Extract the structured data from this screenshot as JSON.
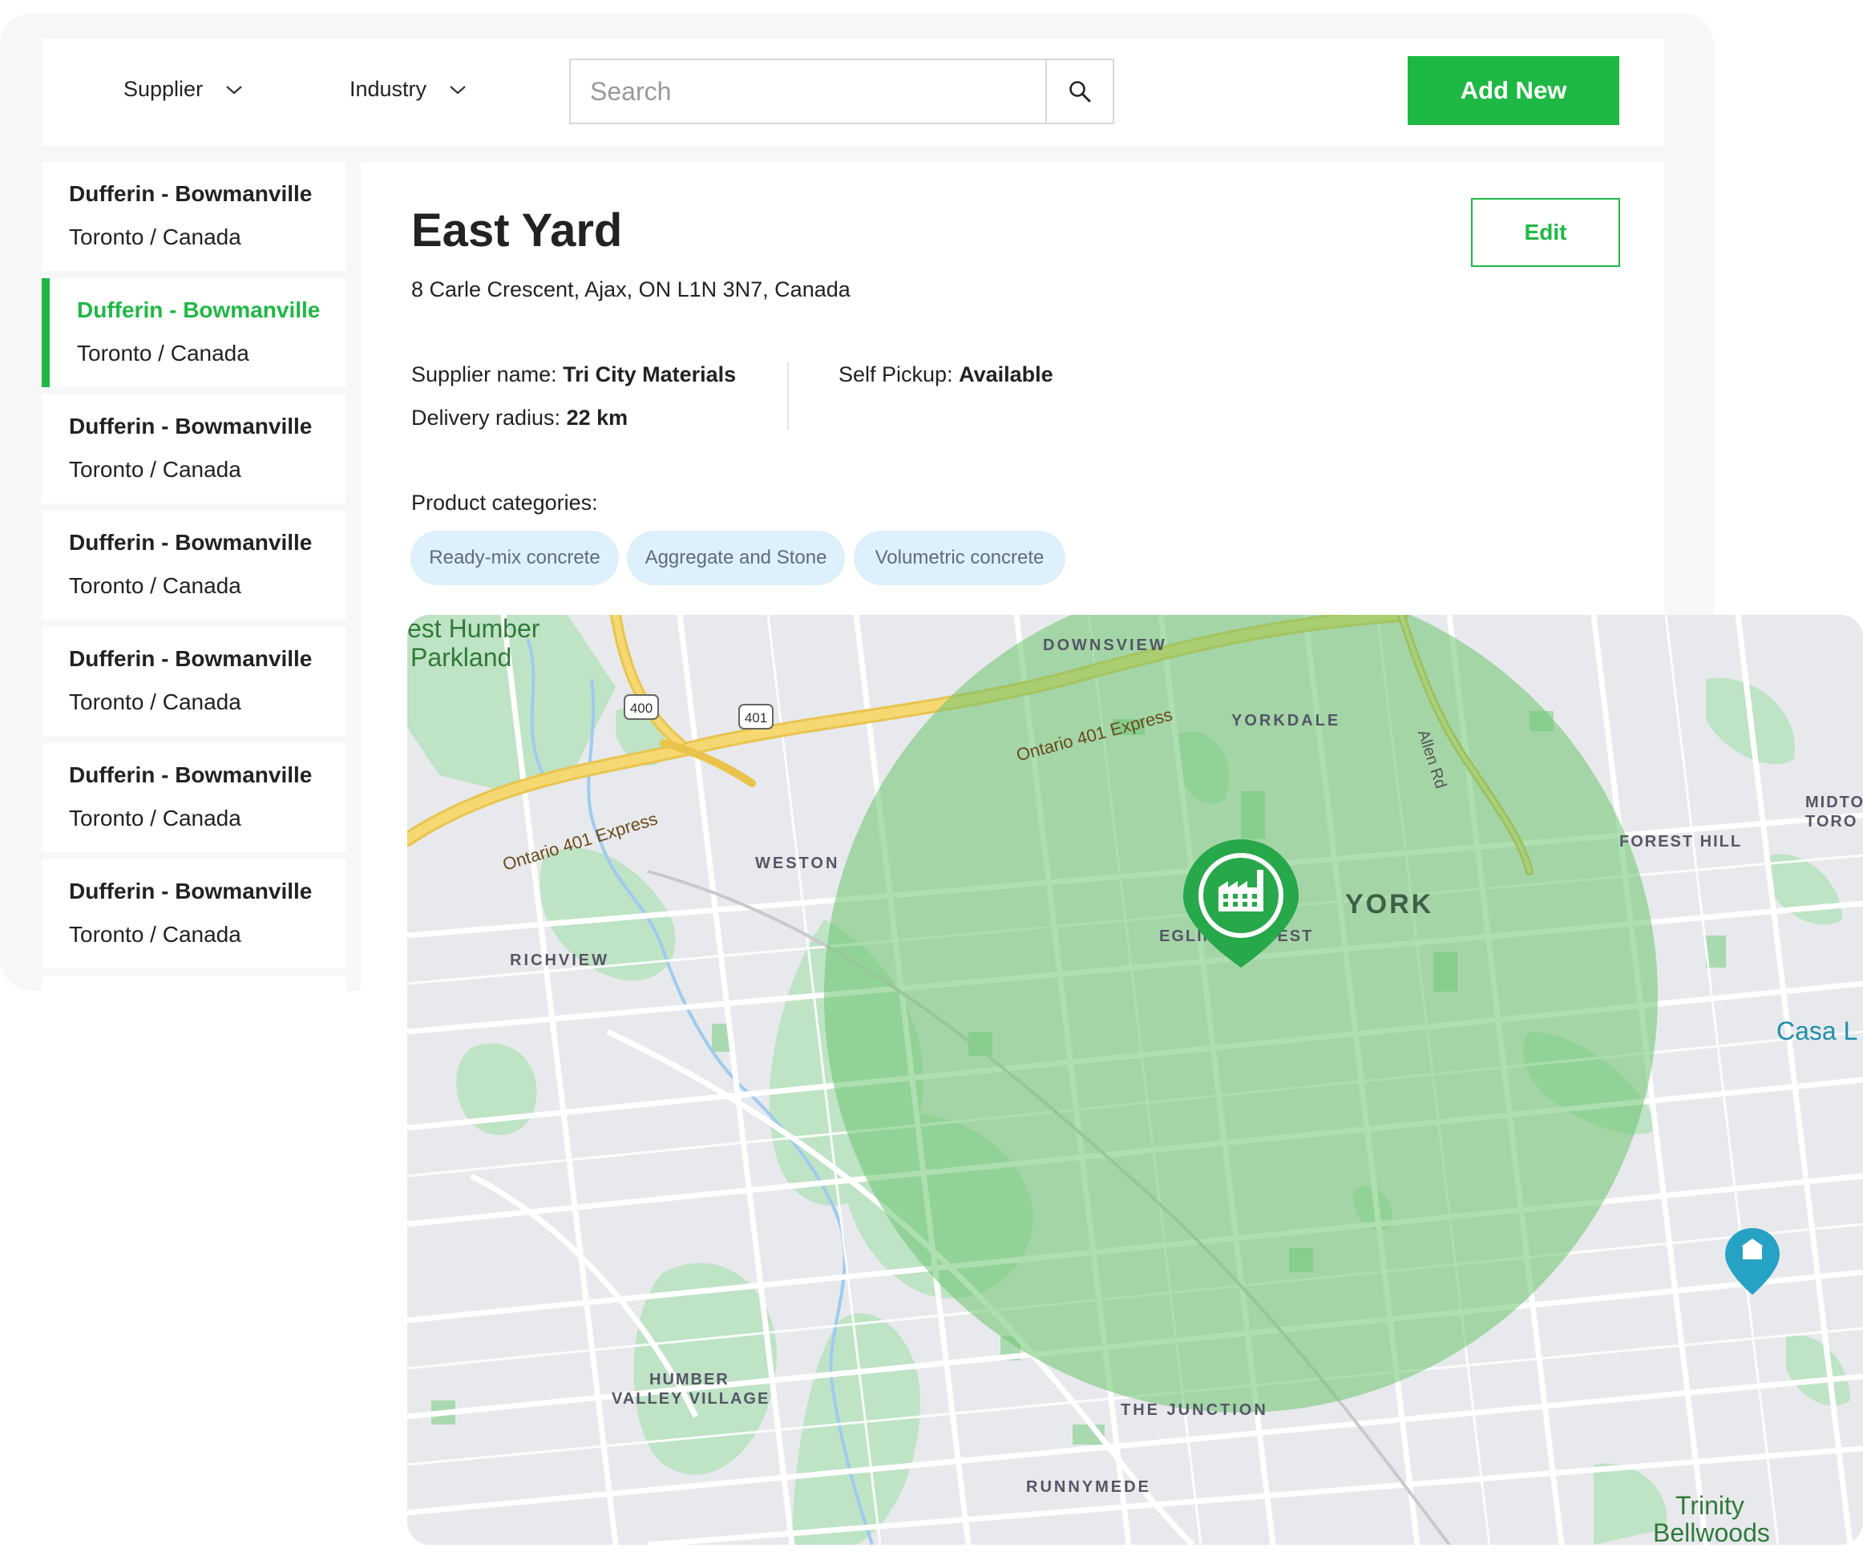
{
  "filters": {
    "supplier_label": "Supplier",
    "industry_label": "Industry",
    "search_placeholder": "Search",
    "add_new_label": "Add New"
  },
  "locations": [
    {
      "name": "Dufferin - Bowmanville",
      "sub": "Toronto / Canada",
      "active": false
    },
    {
      "name": "Dufferin - Bowmanville",
      "sub": "Toronto / Canada",
      "active": true
    },
    {
      "name": "Dufferin - Bowmanville",
      "sub": "Toronto / Canada",
      "active": false
    },
    {
      "name": "Dufferin - Bowmanville",
      "sub": "Toronto / Canada",
      "active": false
    },
    {
      "name": "Dufferin - Bowmanville",
      "sub": "Toronto / Canada",
      "active": false
    },
    {
      "name": "Dufferin - Bowmanville",
      "sub": "Toronto / Canada",
      "active": false
    },
    {
      "name": "Dufferin - Bowmanville",
      "sub": "Toronto / Canada",
      "active": false
    }
  ],
  "detail": {
    "title": "East Yard",
    "address": "8 Carle Crescent, Ajax, ON L1N 3N7, Canada",
    "edit_label": "Edit",
    "supplier_label": "Supplier name: ",
    "supplier_value": "Tri City Materials",
    "radius_label": "Delivery radius: ",
    "radius_value": "22 km",
    "pickup_label": "Self Pickup: ",
    "pickup_value": "Available",
    "categories_label": "Product categories:",
    "categories": [
      "Ready-mix concrete",
      "Aggregate and Stone",
      "Volumetric concrete"
    ]
  },
  "map": {
    "labels": {
      "humber_parkland": "est Humber",
      "humber_parkland_2": "Parkland",
      "downsview": "DOWNSVIEW",
      "yorkdale": "YORKDALE",
      "express_1": "Ontario 401 Express",
      "express_2": "Ontario 401 Express",
      "hwy_400": "400",
      "hwy_401": "401",
      "allen_rd": "Allen Rd",
      "weston": "WESTON",
      "york": "YORK",
      "eglinton_west": "EGLINTON WEST",
      "forest_hill": "FOREST HILL",
      "midtown_1": "MIDTO",
      "midtown_2": "TORO",
      "richview": "RICHVIEW",
      "casa_loma": "Casa L",
      "humber_valley_1": "HUMBER",
      "humber_valley_2": "VALLEY VILLAGE",
      "junction": "THE JUNCTION",
      "runnymede": "RUNNYMEDE",
      "trinity_1": "Trinity",
      "trinity_2": "Bellwoods"
    },
    "radius_color": "#6cc46f",
    "pin_color": "#27a84a"
  },
  "colors": {
    "accent": "#1eb944",
    "chip_bg": "#ddf0fb",
    "chip_text": "#5f6d79"
  }
}
